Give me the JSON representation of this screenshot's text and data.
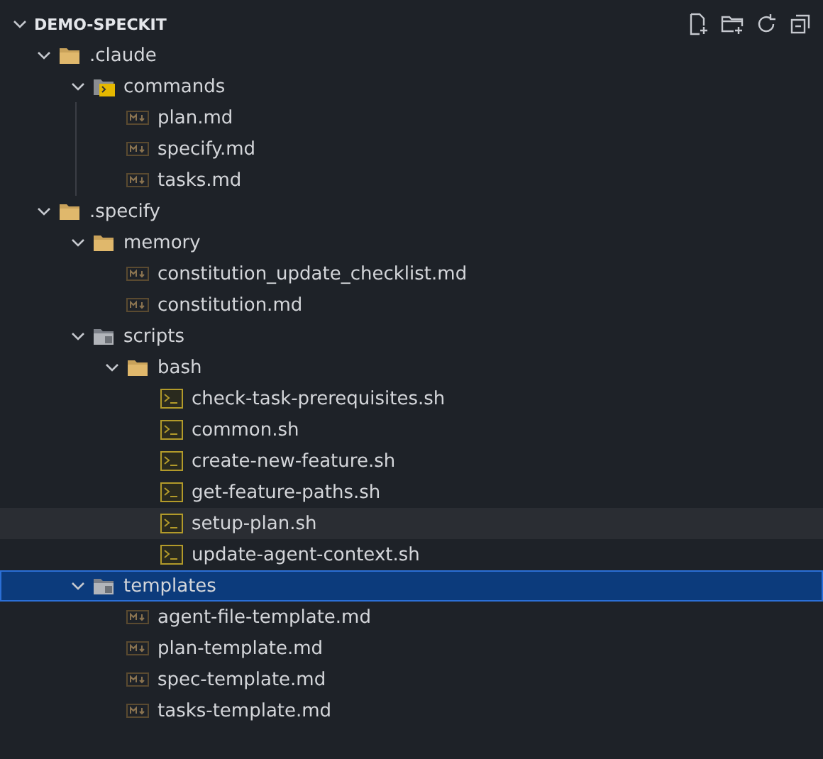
{
  "explorer": {
    "title": "DEMO-SPECKIT",
    "expanded": true
  },
  "tree": [
    {
      "label": ".claude",
      "kind": "folder",
      "expanded": true,
      "selected": false,
      "hovered": false,
      "children": [
        {
          "label": "commands",
          "kind": "terminal-folder",
          "expanded": true,
          "selected": false,
          "hovered": false,
          "children": [
            {
              "label": "plan.md",
              "kind": "markdown",
              "selected": false,
              "hovered": false
            },
            {
              "label": "specify.md",
              "kind": "markdown",
              "selected": false,
              "hovered": false
            },
            {
              "label": "tasks.md",
              "kind": "markdown",
              "selected": false,
              "hovered": false
            }
          ]
        }
      ]
    },
    {
      "label": ".specify",
      "kind": "folder",
      "expanded": true,
      "selected": false,
      "hovered": false,
      "children": [
        {
          "label": "memory",
          "kind": "folder",
          "expanded": true,
          "selected": false,
          "hovered": false,
          "children": [
            {
              "label": "constitution_update_checklist.md",
              "kind": "markdown",
              "selected": false,
              "hovered": false
            },
            {
              "label": "constitution.md",
              "kind": "markdown",
              "selected": false,
              "hovered": false
            }
          ]
        },
        {
          "label": "scripts",
          "kind": "grey-folder",
          "expanded": true,
          "selected": false,
          "hovered": false,
          "children": [
            {
              "label": "bash",
              "kind": "folder",
              "expanded": true,
              "selected": false,
              "hovered": false,
              "children": [
                {
                  "label": "check-task-prerequisites.sh",
                  "kind": "shell",
                  "selected": false,
                  "hovered": false
                },
                {
                  "label": "common.sh",
                  "kind": "shell",
                  "selected": false,
                  "hovered": false
                },
                {
                  "label": "create-new-feature.sh",
                  "kind": "shell",
                  "selected": false,
                  "hovered": false
                },
                {
                  "label": "get-feature-paths.sh",
                  "kind": "shell",
                  "selected": false,
                  "hovered": false
                },
                {
                  "label": "setup-plan.sh",
                  "kind": "shell",
                  "selected": false,
                  "hovered": true
                },
                {
                  "label": "update-agent-context.sh",
                  "kind": "shell",
                  "selected": false,
                  "hovered": false
                }
              ]
            }
          ]
        },
        {
          "label": "templates",
          "kind": "grey-folder",
          "expanded": true,
          "selected": true,
          "hovered": false,
          "children": [
            {
              "label": "agent-file-template.md",
              "kind": "markdown",
              "selected": false,
              "hovered": false
            },
            {
              "label": "plan-template.md",
              "kind": "markdown",
              "selected": false,
              "hovered": false
            },
            {
              "label": "spec-template.md",
              "kind": "markdown",
              "selected": false,
              "hovered": false
            },
            {
              "label": "tasks-template.md",
              "kind": "markdown",
              "selected": false,
              "hovered": false
            }
          ]
        }
      ]
    }
  ]
}
